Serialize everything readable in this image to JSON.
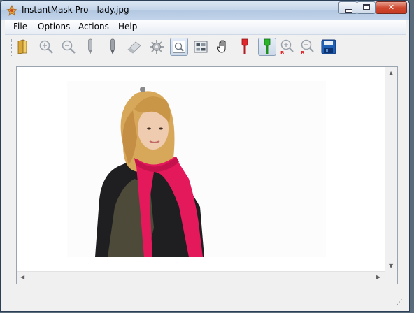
{
  "window": {
    "title": "InstantMask Pro - lady.jpg"
  },
  "menu": [
    {
      "label": "File"
    },
    {
      "label": "Options"
    },
    {
      "label": "Actions"
    },
    {
      "label": "Help"
    }
  ],
  "toolbar": {
    "buttons": [
      {
        "name": "open-folder-icon"
      },
      {
        "name": "zoom-in-icon"
      },
      {
        "name": "zoom-out-icon"
      },
      {
        "name": "pen-gray-icon"
      },
      {
        "name": "pen-dark-icon"
      },
      {
        "name": "eraser-icon"
      },
      {
        "name": "gear-icon"
      },
      {
        "name": "zoom-fit-icon",
        "pressed": true
      },
      {
        "name": "preview-icon"
      },
      {
        "name": "hand-icon"
      },
      {
        "name": "red-brush-icon"
      },
      {
        "name": "green-brush-icon",
        "pressed": true
      },
      {
        "name": "brush-size-increase-icon",
        "badge": "B"
      },
      {
        "name": "brush-size-decrease-icon",
        "badge": "B"
      },
      {
        "name": "save-icon"
      }
    ]
  },
  "colors": {
    "accent_red": "#e0282c",
    "accent_green": "#2bb52b",
    "save_blue": "#1f5fb4",
    "scarf_pink": "#e4195c"
  },
  "canvas": {
    "image_name": "lady.jpg",
    "subject": "woman with blonde hair and pink scarf"
  }
}
